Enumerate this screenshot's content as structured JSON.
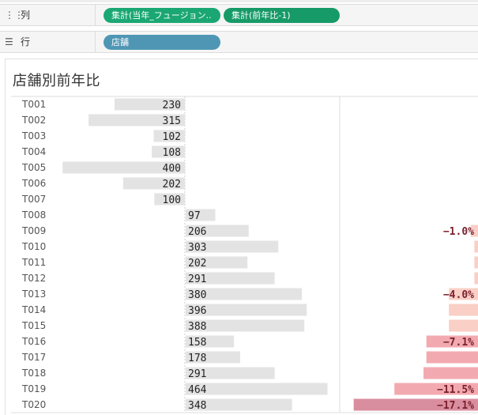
{
  "shelves": {
    "columns": {
      "label": "列",
      "icon": "columns-icon",
      "pills": [
        "集計(当年_フュージョン..",
        "集計(前年比-1)"
      ]
    },
    "rows": {
      "label": "行",
      "icon": "rows-icon",
      "pills": [
        "店舗"
      ]
    }
  },
  "colors": {
    "bar_gray": "#e3e3e3",
    "divider": "#cfcfcf",
    "neg_light": "#f9cfc6",
    "neg_mid": "#f2aab0",
    "neg_dark": "#d98e9f",
    "neg_label": "#7a1f2b"
  },
  "chart_data": {
    "type": "bar",
    "title": "店舗別前年比",
    "categories": [
      "T001",
      "T002",
      "T003",
      "T004",
      "T005",
      "T006",
      "T007",
      "T008",
      "T009",
      "T010",
      "T011",
      "T012",
      "T013",
      "T014",
      "T015",
      "T016",
      "T017",
      "T018",
      "T019",
      "T020"
    ],
    "series": [
      {
        "values": [
          230,
          315,
          102,
          108,
          400,
          202,
          100,
          97,
          206,
          303,
          202,
          291,
          380,
          396,
          388,
          158,
          178,
          291,
          464,
          348
        ],
        "labels": [
          "230",
          "315",
          "102",
          "108",
          "400",
          "202",
          "100",
          "97",
          "206",
          "303",
          "202",
          "291",
          "380",
          "396",
          "388",
          "158",
          "178",
          "291",
          "464",
          "348"
        ]
      },
      {
        "values": [
          null,
          null,
          null,
          null,
          null,
          null,
          null,
          null,
          -1.0,
          -0.5,
          -0.5,
          -0.5,
          -4.0,
          -4.0,
          -4.0,
          -7.1,
          -7.1,
          -7.5,
          -11.5,
          -17.1
        ],
        "labels": [
          "",
          "",
          "",
          "",
          "",
          "",
          "",
          "",
          "−1.0%",
          "",
          "",
          "",
          "−4.0%",
          "",
          "",
          "−7.1%",
          "",
          "",
          "−11.5%",
          "−17.1%"
        ]
      }
    ]
  }
}
